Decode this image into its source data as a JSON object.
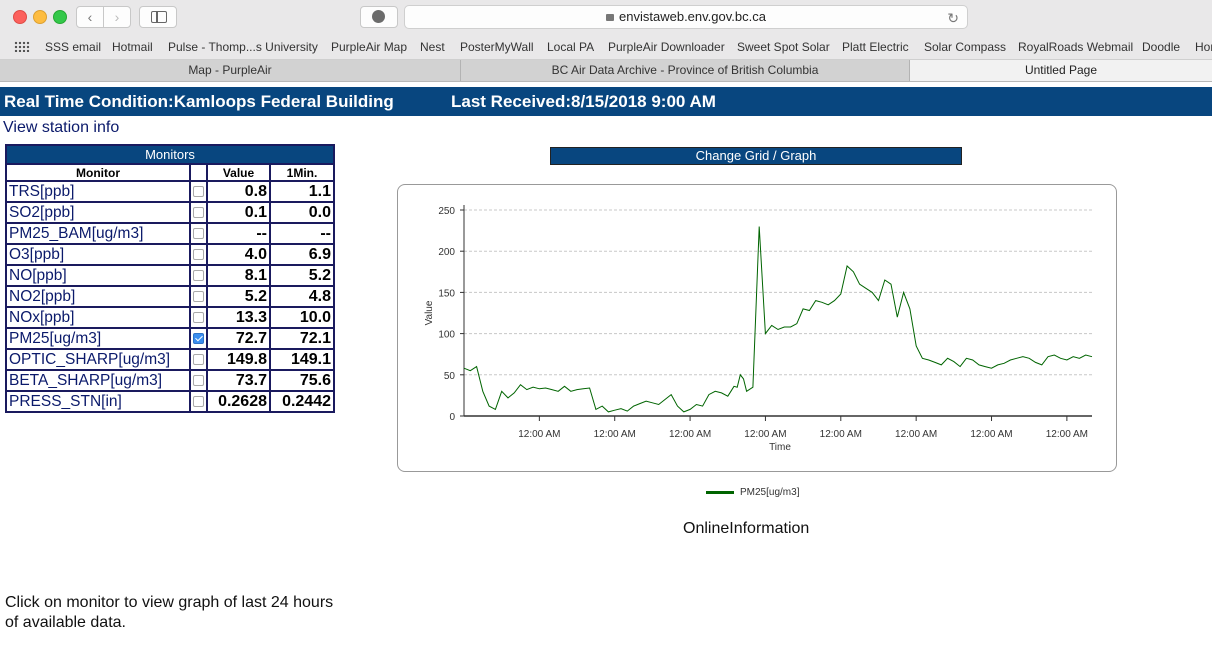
{
  "browser": {
    "url": "envistaweb.env.gov.bc.ca",
    "bookmarks": [
      "SSS email",
      "Hotmail",
      "Pulse - Thomp...s University",
      "PurpleAir Map",
      "Nest",
      "PosterMyWall",
      "Local PA",
      "PurpleAir Downloader",
      "Sweet Spot Solar",
      "Platt Electric",
      "Solar Compass",
      "RoyalRoads Webmail",
      "Doodle",
      "Hor"
    ],
    "tabs": [
      "Map - PurpleAir",
      "BC Air Data Archive - Province of British Columbia",
      "Untitled Page"
    ],
    "active_tab": 2
  },
  "page": {
    "condition_title": "Real Time Condition:Kamloops Federal Building",
    "last_received": "Last Received:8/15/2018 9:00 AM",
    "station_link": "View station info",
    "change_grid_label": "Change Grid / Graph",
    "online_info": "OnlineInformation",
    "instructions": "Click on monitor to view graph of last 24 hours of available data."
  },
  "monitors": {
    "title": "Monitors",
    "headers": [
      "Monitor",
      "",
      "Value",
      "1Min."
    ],
    "rows": [
      {
        "name": "TRS[ppb]",
        "checked": false,
        "value": "0.8",
        "min1": "1.1"
      },
      {
        "name": "SO2[ppb]",
        "checked": false,
        "value": "0.1",
        "min1": "0.0"
      },
      {
        "name": "PM25_BAM[ug/m3]",
        "checked": false,
        "value": "--",
        "min1": "--"
      },
      {
        "name": "O3[ppb]",
        "checked": false,
        "value": "4.0",
        "min1": "6.9"
      },
      {
        "name": "NO[ppb]",
        "checked": false,
        "value": "8.1",
        "min1": "5.2"
      },
      {
        "name": "NO2[ppb]",
        "checked": false,
        "value": "5.2",
        "min1": "4.8"
      },
      {
        "name": "NOx[ppb]",
        "checked": false,
        "value": "13.3",
        "min1": "10.0"
      },
      {
        "name": "PM25[ug/m3]",
        "checked": true,
        "value": "72.7",
        "min1": "72.1"
      },
      {
        "name": "OPTIC_SHARP[ug/m3]",
        "checked": false,
        "value": "149.8",
        "min1": "149.1"
      },
      {
        "name": "BETA_SHARP[ug/m3]",
        "checked": false,
        "value": "73.7",
        "min1": "75.6"
      },
      {
        "name": "PRESS_STN[in]",
        "checked": false,
        "value": "0.2628",
        "min1": "0.2442"
      }
    ]
  },
  "chart_data": {
    "type": "line",
    "xlabel": "Time",
    "ylabel": "Value",
    "ylim": [
      0,
      250
    ],
    "yticks": [
      0,
      50,
      100,
      150,
      200,
      250
    ],
    "xticks": [
      "12:00 AM",
      "12:00 AM",
      "12:00 AM",
      "12:00 AM",
      "12:00 AM",
      "12:00 AM",
      "12:00 AM",
      "12:00 AM"
    ],
    "xtick_positions_hours": [
      24,
      48,
      72,
      96,
      120,
      144,
      168,
      192
    ],
    "x_range_hours": [
      0,
      200
    ],
    "grid": true,
    "legend": "bottom",
    "series": [
      {
        "name": "PM25[ug/m3]",
        "color": "#006400",
        "x": [
          0,
          2,
          4,
          6,
          8,
          10,
          12,
          14,
          16,
          18,
          20,
          22,
          24,
          26,
          28,
          30,
          32,
          34,
          36,
          38,
          40,
          42,
          44,
          46,
          48,
          50,
          52,
          54,
          56,
          58,
          60,
          62,
          64,
          66,
          68,
          70,
          72,
          74,
          76,
          78,
          80,
          82,
          84,
          85,
          86,
          87,
          88,
          89,
          90,
          92,
          94,
          96,
          98,
          100,
          102,
          104,
          106,
          108,
          110,
          112,
          114,
          116,
          118,
          120,
          122,
          124,
          126,
          128,
          130,
          132,
          134,
          136,
          138,
          140,
          142,
          144,
          146,
          148,
          150,
          152,
          154,
          156,
          158,
          160,
          162,
          164,
          166,
          168,
          170,
          172,
          174,
          176,
          178,
          180,
          182,
          184,
          186,
          188,
          190,
          192,
          194,
          196,
          198,
          200
        ],
        "y": [
          58,
          55,
          60,
          30,
          12,
          8,
          30,
          22,
          28,
          38,
          32,
          35,
          33,
          34,
          32,
          30,
          36,
          30,
          32,
          33,
          34,
          8,
          12,
          5,
          7,
          9,
          6,
          12,
          15,
          18,
          16,
          14,
          20,
          26,
          12,
          5,
          8,
          14,
          12,
          26,
          30,
          28,
          24,
          30,
          36,
          35,
          50,
          45,
          30,
          35,
          230,
          100,
          110,
          105,
          108,
          108,
          112,
          130,
          128,
          140,
          138,
          135,
          140,
          148,
          182,
          175,
          160,
          155,
          150,
          140,
          165,
          160,
          120,
          150,
          130,
          85,
          70,
          68,
          65,
          62,
          70,
          66,
          60,
          70,
          68,
          62,
          60,
          58,
          62,
          64,
          68,
          70,
          72,
          70,
          65,
          62,
          72,
          74,
          70,
          68,
          72,
          70,
          74,
          72
        ]
      }
    ]
  }
}
